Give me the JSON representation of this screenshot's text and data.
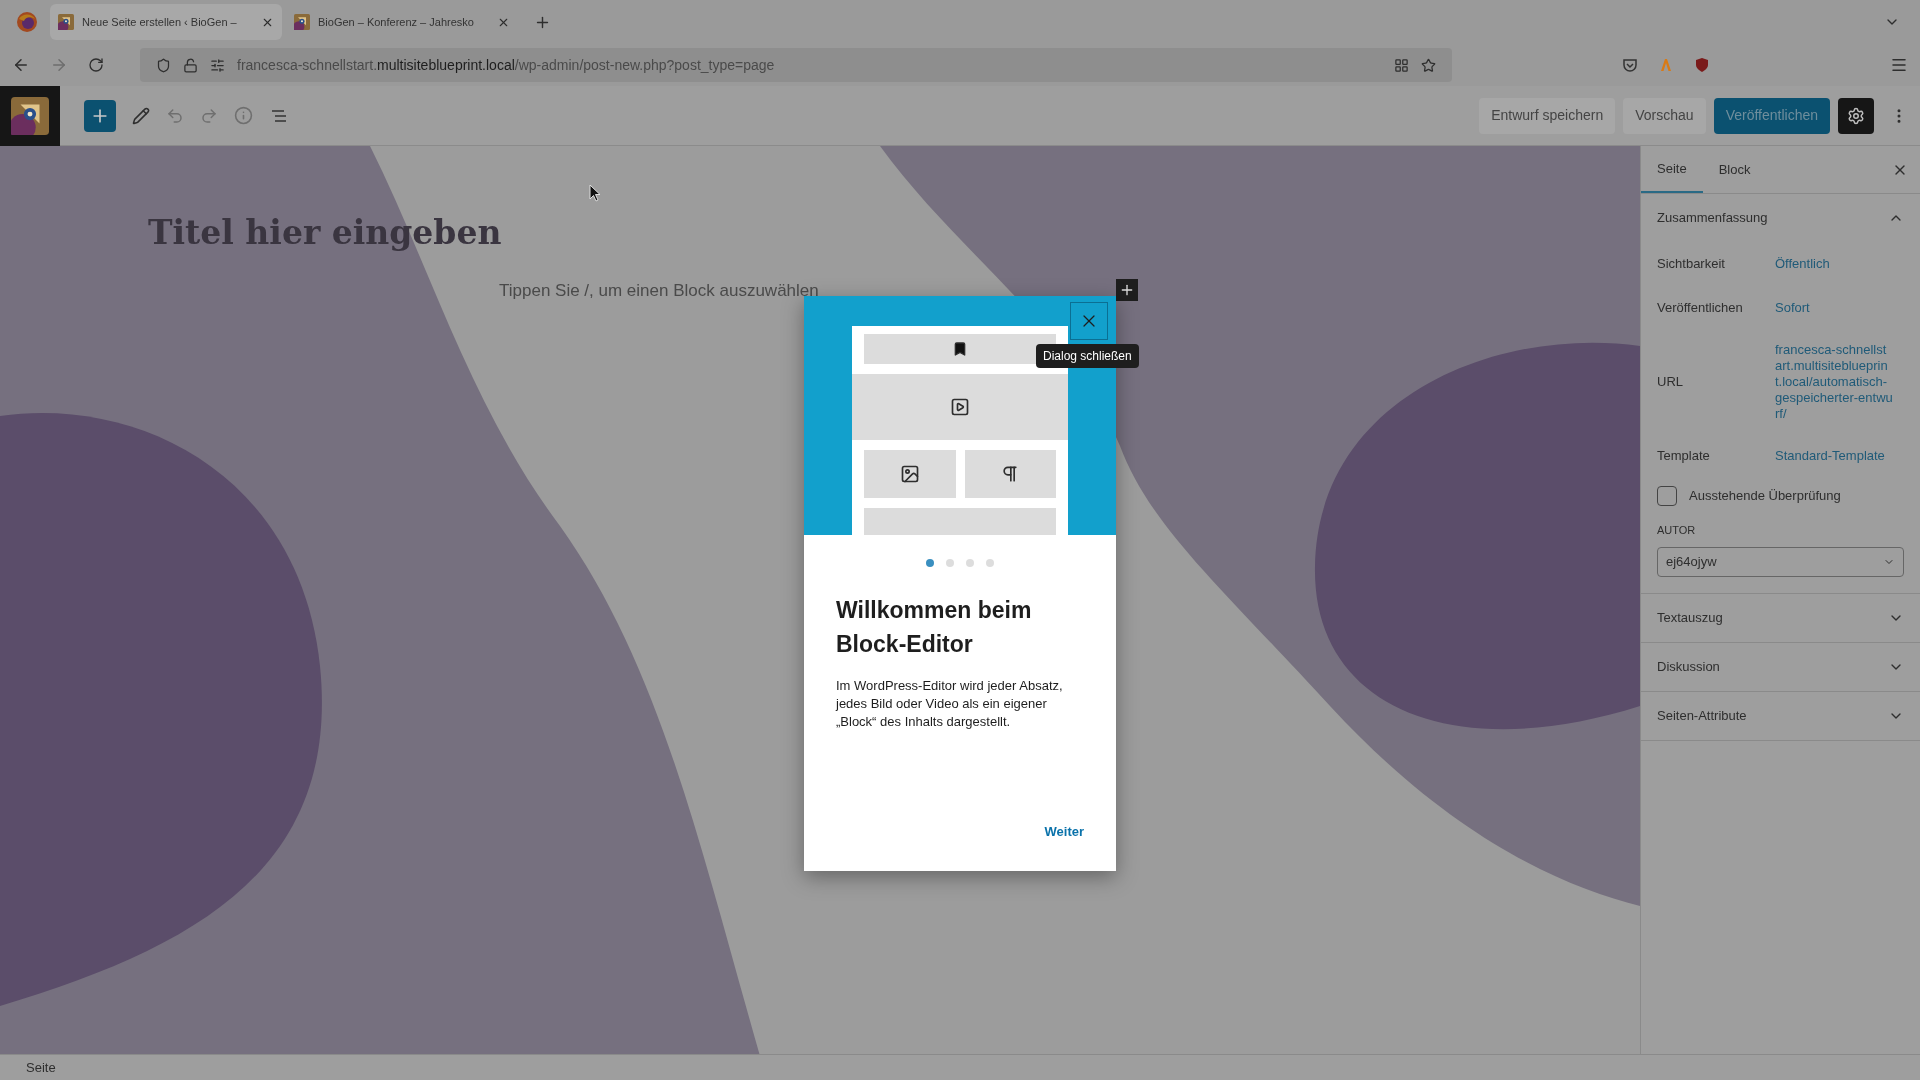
{
  "browser": {
    "tabs": [
      {
        "title": "Neue Seite erstellen ‹ BioGen –",
        "selected": true
      },
      {
        "title": "BioGen – Konferenz – Jahresko",
        "selected": false
      }
    ],
    "url": {
      "prefix": "francesca-schnellstart.",
      "host": "multisiteblueprint.local",
      "path": "/wp-admin/post-new.php?post_type=page"
    }
  },
  "toolbar": {
    "save_draft": "Entwurf speichern",
    "preview": "Vorschau",
    "publish": "Veröffentlichen",
    "settings_on": true
  },
  "editor": {
    "title_placeholder": "Titel hier eingeben",
    "block_placeholder": "Tippen Sie /, um einen Block auszuwählen"
  },
  "sidebar": {
    "tabs": [
      {
        "label": "Seite",
        "selected": true
      },
      {
        "label": "Block",
        "selected": false
      }
    ],
    "summary": {
      "title": "Zusammenfassung",
      "expanded": true,
      "rows": [
        {
          "label": "Sichtbarkeit",
          "value": "Öffentlich"
        },
        {
          "label": "Veröffentlichen",
          "value": "Sofort"
        },
        {
          "label": "URL",
          "value": "francesca-schnellstart.multisiteblueprint.local/automatisch-gespeicherter-entwurf/"
        },
        {
          "label": "Template",
          "value": "Standard-Template"
        }
      ],
      "checkbox": {
        "label": "Ausstehende Überprüfung",
        "checked": false
      },
      "author": {
        "label": "AUTOR",
        "value": "ej64ojyw"
      }
    },
    "panels": [
      {
        "title": "Textauszug",
        "expanded": false
      },
      {
        "title": "Diskussion",
        "expanded": false
      },
      {
        "title": "Seiten-Attribute",
        "expanded": false
      }
    ]
  },
  "modal": {
    "pages": [
      {
        "selected": true
      },
      {
        "selected": false
      },
      {
        "selected": false
      },
      {
        "selected": false
      }
    ],
    "title": "Willkommen beim Block-Editor",
    "body": "Im WordPress-Editor wird jeder Absatz, jedes Bild oder Video als ein eigener „Block“ des Inhalts dargestellt.",
    "next": "Weiter",
    "close_tooltip": "Dialog schließen"
  },
  "status_bar": {
    "text": "Seite"
  }
}
